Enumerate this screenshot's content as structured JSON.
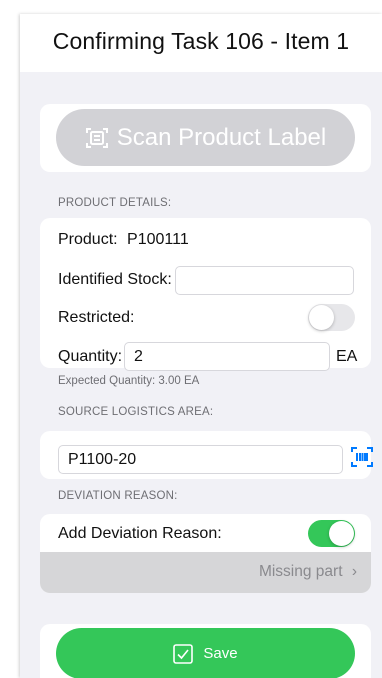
{
  "header": {
    "title": "Confirming Task 106 - Item 1"
  },
  "scan": {
    "label": "Scan Product Label",
    "icon": "document-scan-icon"
  },
  "product_details": {
    "section_label": "PRODUCT DETAILS:",
    "product_label": "Product:",
    "product_value": "P100111",
    "identified_stock_label": "Identified Stock:",
    "identified_stock_value": "",
    "restricted_label": "Restricted:",
    "restricted_on": false,
    "quantity_label": "Quantity:",
    "quantity_value": "2",
    "quantity_unit": "EA"
  },
  "expected_quantity": "Expected Quantity: 3.00 EA",
  "source": {
    "section_label": "SOURCE LOGISTICS AREA:",
    "value": "P1100-20",
    "scan_icon": "barcode-scan-icon"
  },
  "deviation": {
    "section_label": "DEVIATION REASON:",
    "add_label": "Add Deviation Reason:",
    "add_on": true,
    "reason_value": "Missing part",
    "chevron_icon": "chevron-right-icon"
  },
  "footer": {
    "save_label": "Save",
    "save_icon": "checkbox-icon"
  },
  "colors": {
    "accent_green": "#34c759",
    "accent_blue": "#007aff",
    "disabled_grey": "#d2d2d6"
  }
}
